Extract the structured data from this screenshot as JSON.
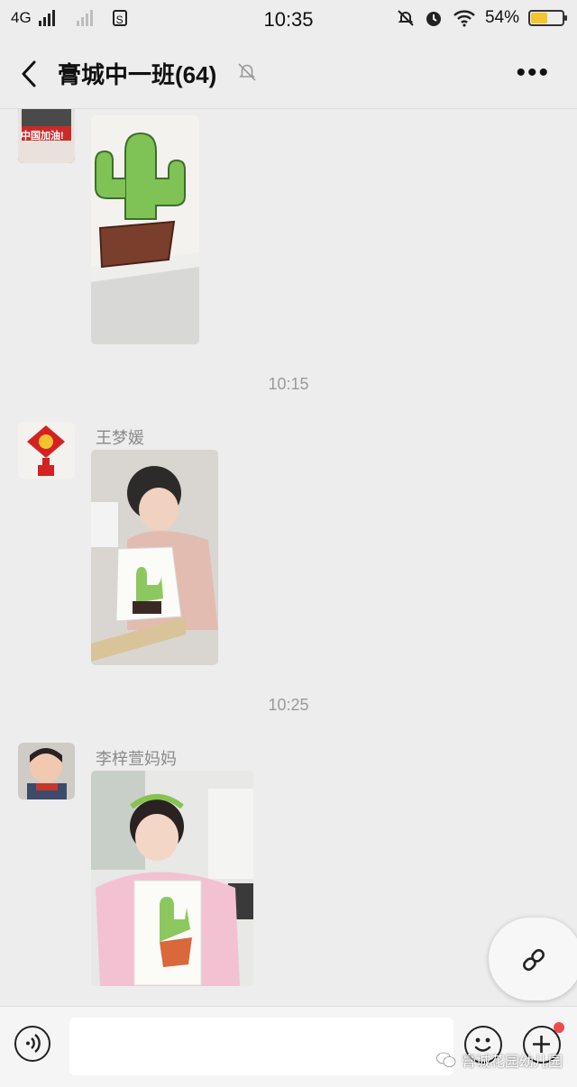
{
  "status_bar": {
    "network": "4G",
    "time": "10:35",
    "battery_percent": 54
  },
  "nav": {
    "title": "膏城中一班(64)"
  },
  "messages": [
    {
      "avatar_caption": "中国加油!"
    },
    {
      "timestamp": "10:15",
      "sender": "王梦媛"
    },
    {
      "timestamp": "10:25",
      "sender": "李梓萱妈妈"
    }
  ],
  "watermark": "膏城花园幼儿园",
  "colors": {
    "background": "#ededed",
    "battery": "#f2c531",
    "badge": "#f04b4b",
    "timestamp": "#9a9a9a"
  }
}
